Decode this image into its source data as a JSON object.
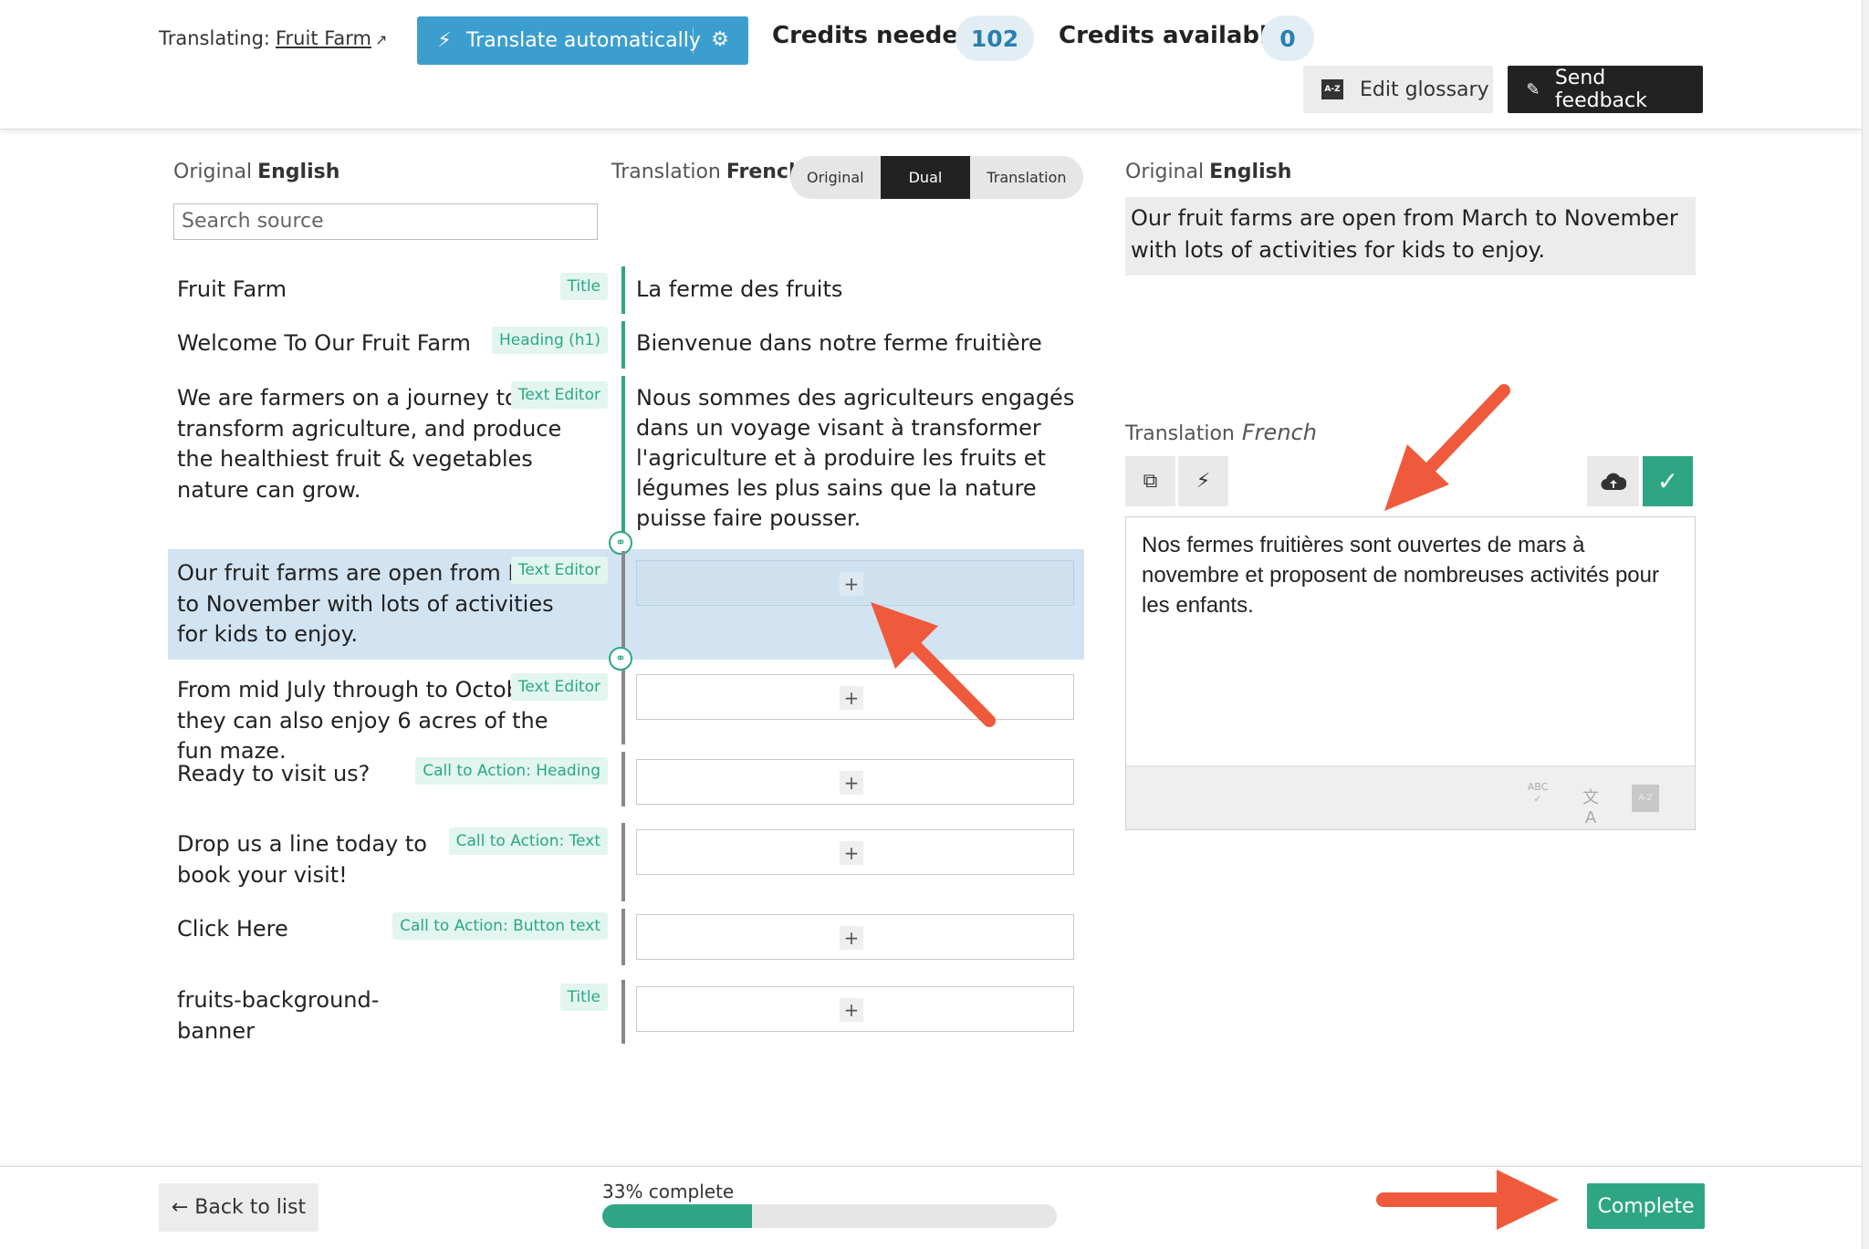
{
  "header": {
    "translating_label": "Translating:",
    "project_link": "Fruit Farm",
    "external_icon": "external-link-icon",
    "auto_button": "Translate automatically",
    "credits_needed_label": "Credits needed",
    "credits_needed_value": "102",
    "credits_available_label": "Credits available",
    "credits_available_value": "0",
    "edit_glossary": "Edit glossary",
    "send_feedback": "Send feedback"
  },
  "columns": {
    "original_label": "Original",
    "original_lang": "English",
    "translation_label": "Translation",
    "translation_lang": "French",
    "search_placeholder": "Search source",
    "view_toggle": {
      "options": [
        "Original",
        "Dual",
        "Translation"
      ],
      "selected": "Dual"
    }
  },
  "rows": [
    {
      "source": "Fruit Farm",
      "tag": "Title",
      "translation": "La ferme des fruits"
    },
    {
      "source": "Welcome To Our Fruit Farm",
      "tag": "Heading (h1)",
      "translation": "Bienvenue dans notre ferme fruitière"
    },
    {
      "source": "We are farmers on a journey to transform agriculture, and produce the healthiest fruit & vegetables nature can grow.",
      "tag": "Text Editor",
      "translation": "Nous sommes des agriculteurs engagés dans un voyage visant à transformer l'agriculture et à produire les fruits et légumes les plus sains que la nature puisse faire pousser."
    },
    {
      "source": "Our fruit farms are open from March to November with lots of activities for kids to enjoy.",
      "tag": "Text Editor",
      "translation": "+"
    },
    {
      "source": "From mid July through to October they can also enjoy 6 acres of the fun maze.",
      "tag": "Text Editor",
      "translation": "+"
    },
    {
      "source": "Ready to visit us?",
      "tag": "Call to Action: Heading",
      "translation": "+"
    },
    {
      "source": "Drop us a line today to book your visit!",
      "tag": "Call to Action: Text",
      "translation": "+"
    },
    {
      "source": "Click Here",
      "tag": "Call to Action: Button text",
      "translation": "+"
    },
    {
      "source": "fruits-background-banner",
      "tag": "Title",
      "translation": "+"
    }
  ],
  "editor": {
    "original_label": "Original",
    "original_lang": "English",
    "original_text": "Our fruit farms are open from March to November with lots of activities for kids to enjoy.",
    "translation_label": "Translation",
    "translation_lang": "French",
    "translation_text": "Nos fermes fruitières sont ouvertes de mars à novembre et proposent de nombreuses activités pour les enfants."
  },
  "footer": {
    "back_label": "← Back to list",
    "progress_label": "33% complete",
    "progress_fraction": 0.33,
    "complete_label": "Complete"
  },
  "colors": {
    "accent_blue": "#3c9ecf",
    "accent_green": "#2ea684",
    "annotation_red": "#ef5a3c",
    "selected_row": "#d2e4f2"
  }
}
